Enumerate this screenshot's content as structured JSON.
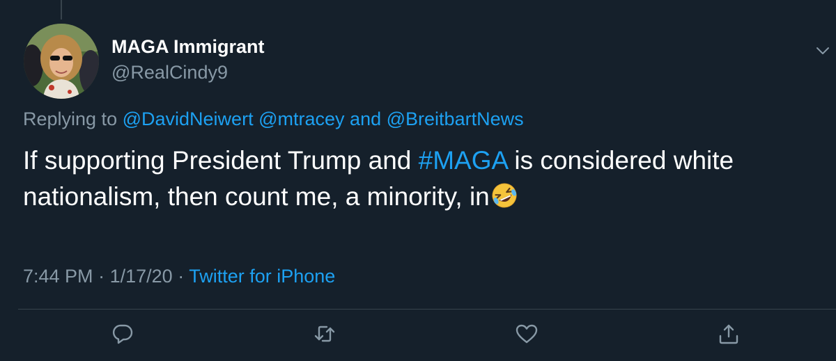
{
  "tweet": {
    "author": {
      "display_name": "MAGA Immigrant",
      "handle": "@RealCindy9"
    },
    "replying_to": {
      "prefix": "Replying to",
      "mention_1": "@DavidNeiwert",
      "mention_2": "@mtracey",
      "conjunction": "and",
      "mention_3": "@BreitbartNews"
    },
    "text": {
      "part_1": "If supporting President Trump and ",
      "hashtag": "#MAGA",
      "part_2": " is considered white nationalism, then count me, a minority, in",
      "emoji": "rolling-on-floor-laughing"
    },
    "meta": {
      "time": "7:44 PM",
      "separator": "·",
      "date": "1/17/20",
      "source": "Twitter for iPhone"
    }
  },
  "actions": {
    "reply": "reply-icon",
    "retweet": "retweet-icon",
    "like": "heart-icon",
    "share": "share-icon"
  },
  "colors": {
    "background": "#15202b",
    "primary_text": "#ffffff",
    "secondary_text": "#8899a6",
    "link": "#1da1f2",
    "divider": "#38444d"
  }
}
